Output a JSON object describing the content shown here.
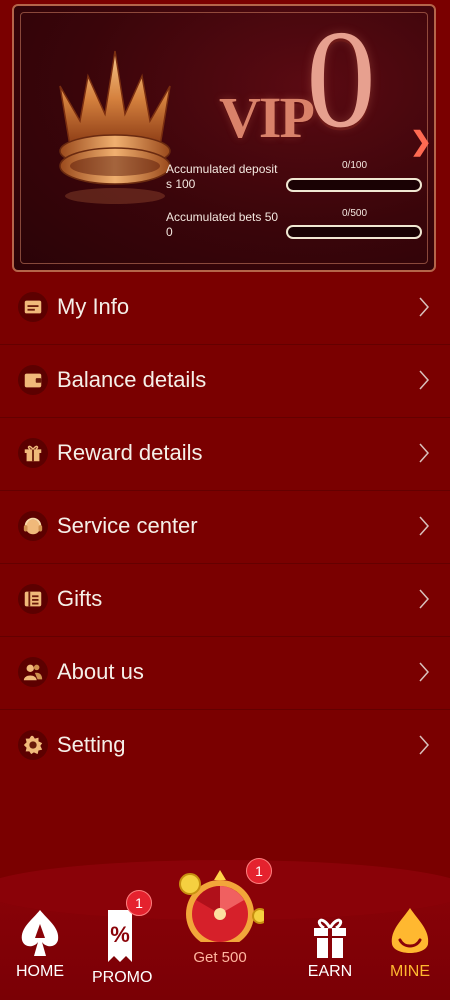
{
  "vip_card": {
    "vip_word": "VIP",
    "level": "0",
    "deposit_label": "Accumulated deposit\ns 100",
    "deposit_count": "0/100",
    "deposit_progress": 0,
    "bets_label": "Accumulated bets 50\n0",
    "bets_count": "0/500",
    "bets_progress": 0
  },
  "menu": {
    "items": [
      {
        "label": "My Info",
        "icon": "id-card-icon"
      },
      {
        "label": "Balance details",
        "icon": "wallet-icon"
      },
      {
        "label": "Reward details",
        "icon": "gift-box-icon"
      },
      {
        "label": "Service center",
        "icon": "headset-icon"
      },
      {
        "label": "Gifts",
        "icon": "ticket-icon"
      },
      {
        "label": "About us",
        "icon": "users-icon"
      },
      {
        "label": "Setting",
        "icon": "gear-icon"
      }
    ]
  },
  "bottom_nav": {
    "home": "HOME",
    "promo": "PROMO",
    "promo_badge": "1",
    "center": "Get 500",
    "center_badge": "1",
    "earn": "EARN",
    "mine": "MINE"
  },
  "colors": {
    "background": "#7a0000",
    "accent": "#ffb830",
    "badge": "#e5222e"
  }
}
